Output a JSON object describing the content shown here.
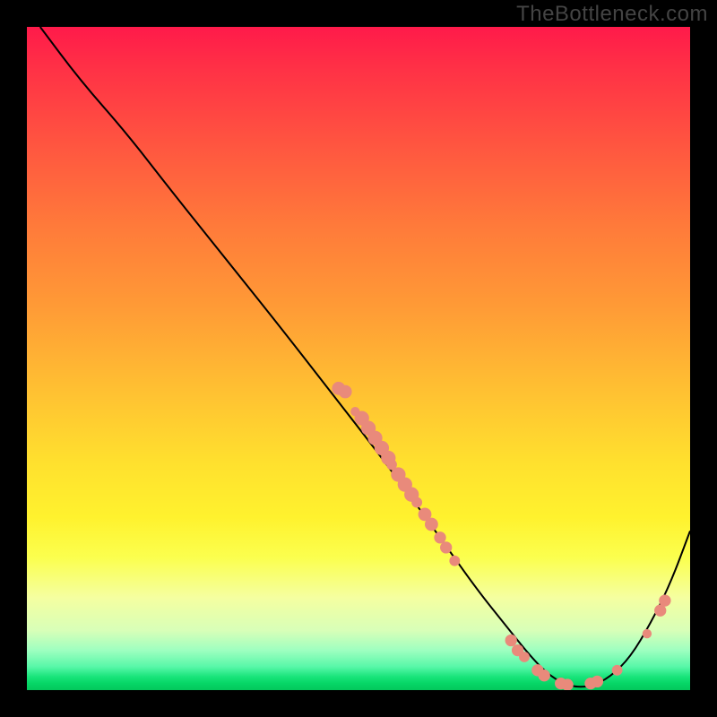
{
  "watermark": "TheBottleneck.com",
  "chart_data": {
    "type": "line",
    "title": "",
    "xlabel": "",
    "ylabel": "",
    "xlim": [
      0,
      100
    ],
    "ylim": [
      0,
      100
    ],
    "grid": false,
    "legend": false,
    "series": [
      {
        "name": "bottleneck-curve",
        "color": "#000000",
        "x": [
          2,
          8,
          15,
          22,
          30,
          38,
          45,
          52,
          58,
          63,
          68,
          72,
          76,
          79,
          82,
          85,
          88,
          91,
          94,
          97,
          100
        ],
        "y": [
          100,
          92,
          84,
          75,
          65,
          55,
          46,
          37,
          29,
          22,
          15,
          10,
          5,
          2,
          0.5,
          0.5,
          2,
          5,
          10,
          16,
          24
        ]
      }
    ],
    "markers": {
      "name": "cluster-dots",
      "color": "#e98a7b",
      "points": [
        {
          "x": 47,
          "y": 45.5,
          "r": 1.0
        },
        {
          "x": 48,
          "y": 45,
          "r": 1.0
        },
        {
          "x": 49.5,
          "y": 42,
          "r": 0.7
        },
        {
          "x": 50.5,
          "y": 41,
          "r": 1.1
        },
        {
          "x": 51.5,
          "y": 39.5,
          "r": 1.1
        },
        {
          "x": 52.5,
          "y": 38,
          "r": 1.1
        },
        {
          "x": 53.5,
          "y": 36.5,
          "r": 1.1
        },
        {
          "x": 54.5,
          "y": 35,
          "r": 1.1
        },
        {
          "x": 55,
          "y": 34,
          "r": 0.8
        },
        {
          "x": 56,
          "y": 32.5,
          "r": 1.1
        },
        {
          "x": 57,
          "y": 31,
          "r": 1.1
        },
        {
          "x": 58,
          "y": 29.5,
          "r": 1.1
        },
        {
          "x": 58.8,
          "y": 28.3,
          "r": 0.8
        },
        {
          "x": 60,
          "y": 26.5,
          "r": 1.0
        },
        {
          "x": 61,
          "y": 25,
          "r": 1.0
        },
        {
          "x": 62.3,
          "y": 23,
          "r": 0.9
        },
        {
          "x": 63.2,
          "y": 21.5,
          "r": 0.9
        },
        {
          "x": 64.5,
          "y": 19.5,
          "r": 0.8
        },
        {
          "x": 73,
          "y": 7.5,
          "r": 0.9
        },
        {
          "x": 74,
          "y": 6,
          "r": 0.9
        },
        {
          "x": 75,
          "y": 5,
          "r": 0.8
        },
        {
          "x": 77,
          "y": 3,
          "r": 0.9
        },
        {
          "x": 78,
          "y": 2.2,
          "r": 0.9
        },
        {
          "x": 80.5,
          "y": 1,
          "r": 0.9
        },
        {
          "x": 81.5,
          "y": 0.8,
          "r": 0.9
        },
        {
          "x": 85,
          "y": 1,
          "r": 0.9
        },
        {
          "x": 86,
          "y": 1.3,
          "r": 0.9
        },
        {
          "x": 89,
          "y": 3,
          "r": 0.8
        },
        {
          "x": 93.5,
          "y": 8.5,
          "r": 0.7
        },
        {
          "x": 95.5,
          "y": 12,
          "r": 0.9
        },
        {
          "x": 96.2,
          "y": 13.5,
          "r": 0.9
        }
      ]
    },
    "gradient_stops": [
      {
        "pos": 0,
        "color": "#ff1a4a"
      },
      {
        "pos": 18,
        "color": "#ff5640"
      },
      {
        "pos": 42,
        "color": "#ff9a36"
      },
      {
        "pos": 66,
        "color": "#ffe12e"
      },
      {
        "pos": 86,
        "color": "#f5ffa0"
      },
      {
        "pos": 96,
        "color": "#57f7a8"
      },
      {
        "pos": 100,
        "color": "#03c75c"
      }
    ]
  }
}
